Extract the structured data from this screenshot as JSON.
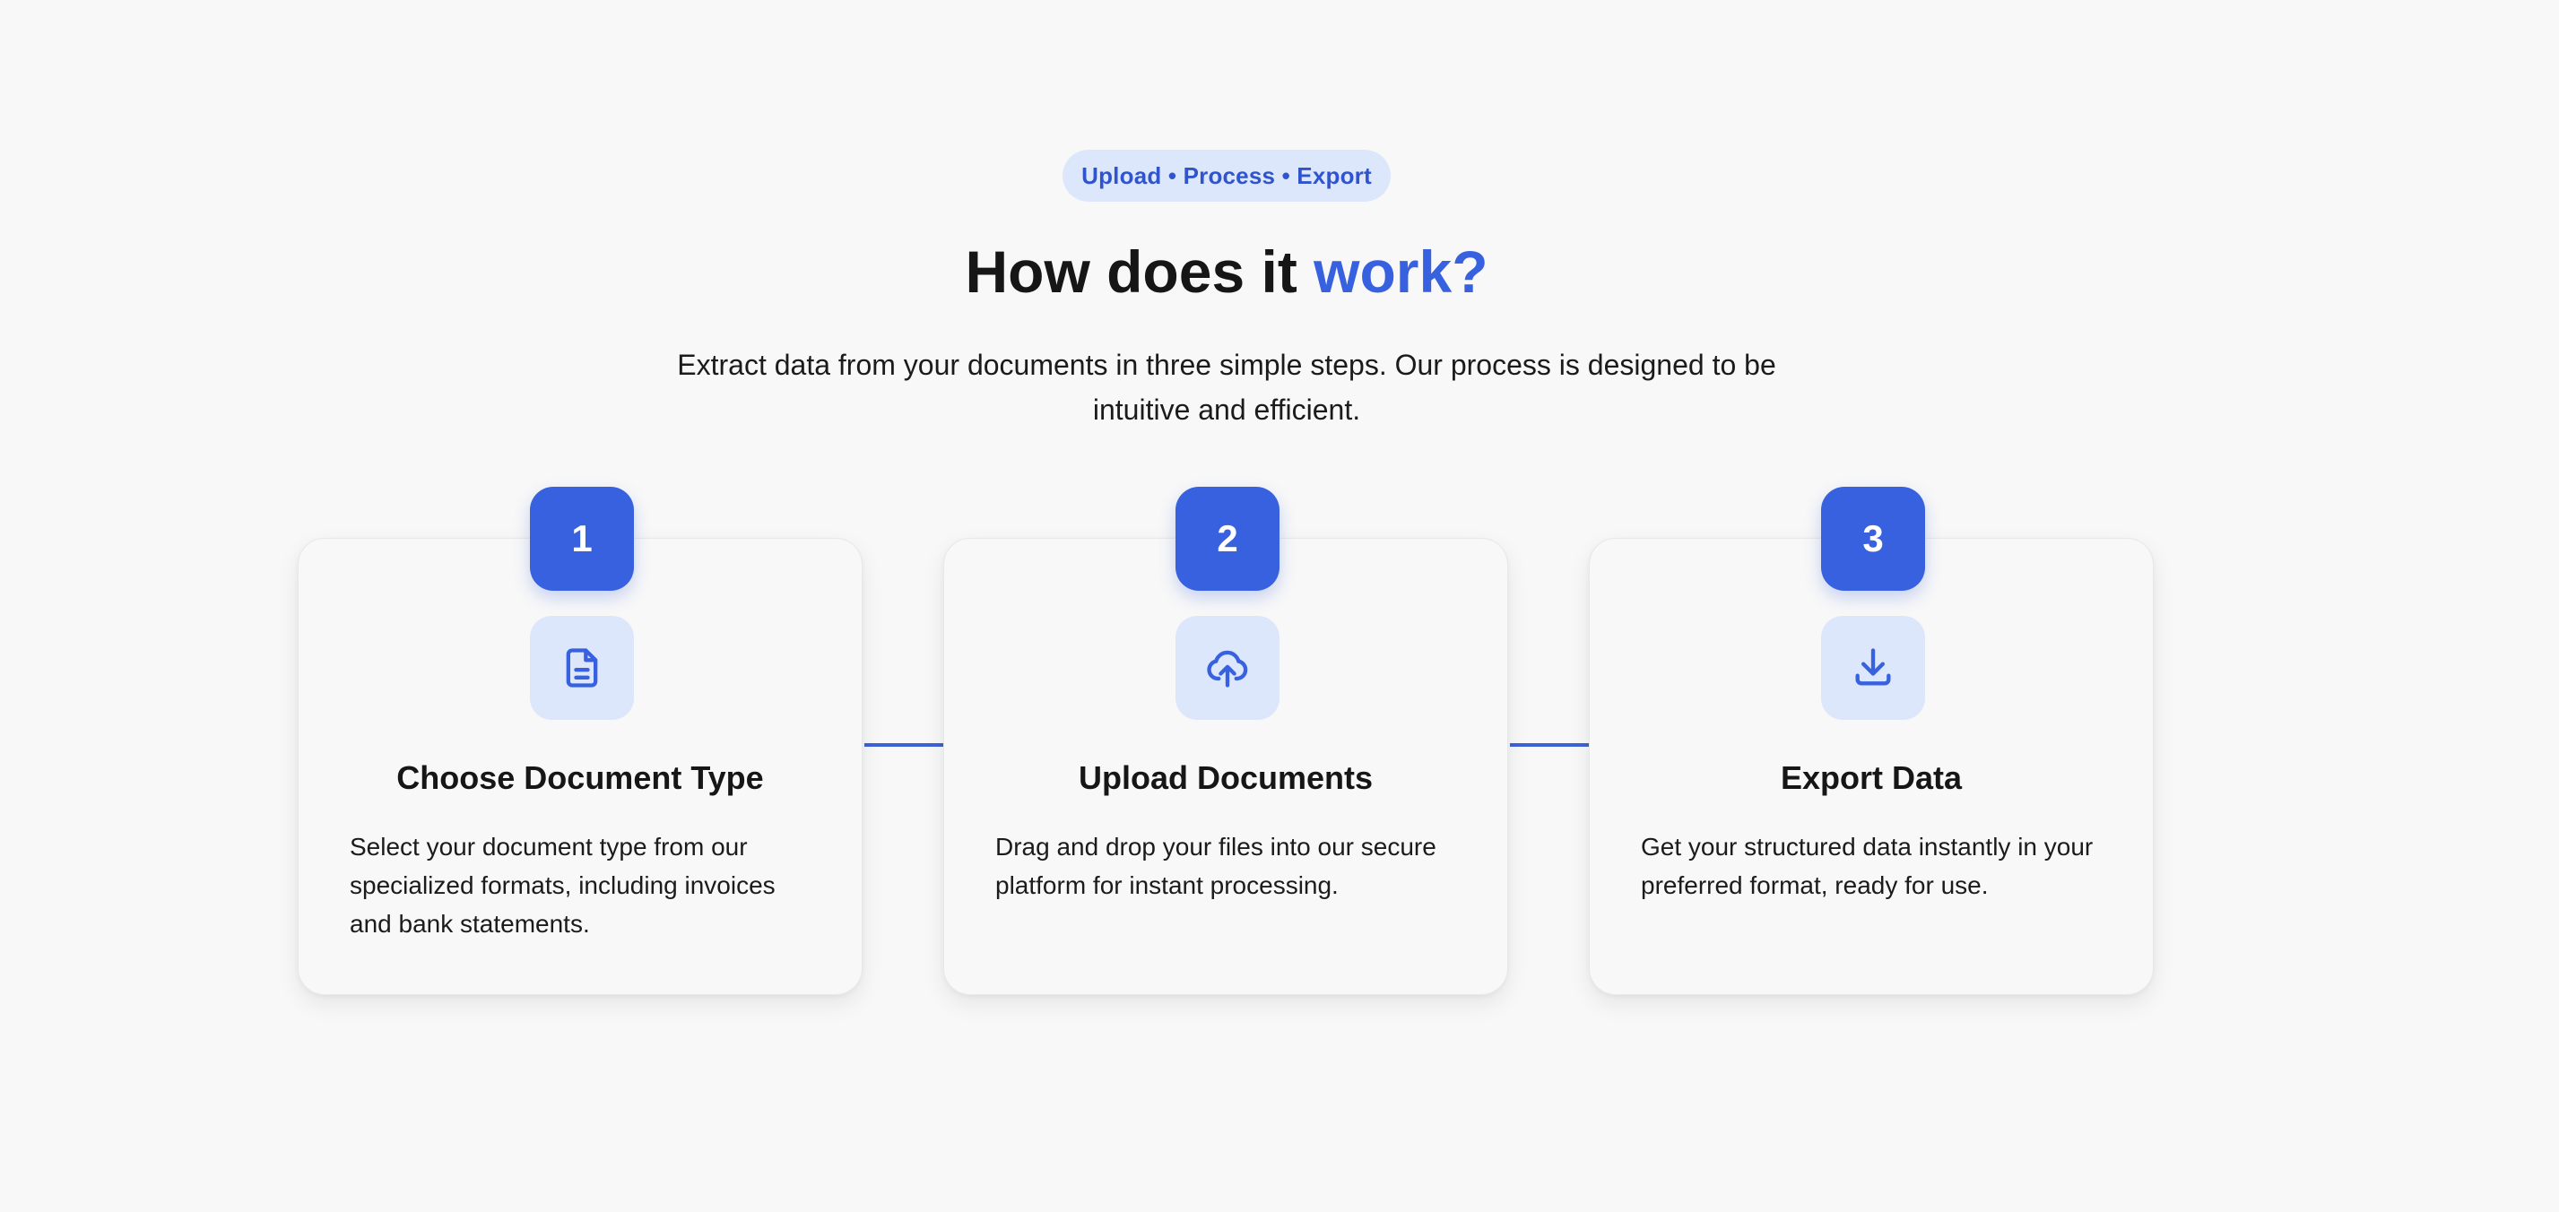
{
  "header": {
    "badge": "Upload • Process • Export",
    "title_main": "How does it ",
    "title_accent": "work?",
    "subtitle": "Extract data from your documents in three simple steps. Our process is designed to be intuitive and efficient."
  },
  "steps": [
    {
      "number": "1",
      "icon": "document-icon",
      "title": "Choose Document Type",
      "description": "Select your document type from our specialized formats, including invoices and bank statements."
    },
    {
      "number": "2",
      "icon": "cloud-upload-icon",
      "title": "Upload Documents",
      "description": "Drag and drop your files into our secure platform for instant processing."
    },
    {
      "number": "3",
      "icon": "download-icon",
      "title": "Export Data",
      "description": "Get your structured data instantly in your preferred format, ready for use."
    }
  ],
  "colors": {
    "accent": "#3861e0",
    "badge_bg": "#dde7fb",
    "background": "#f8f8f8"
  }
}
